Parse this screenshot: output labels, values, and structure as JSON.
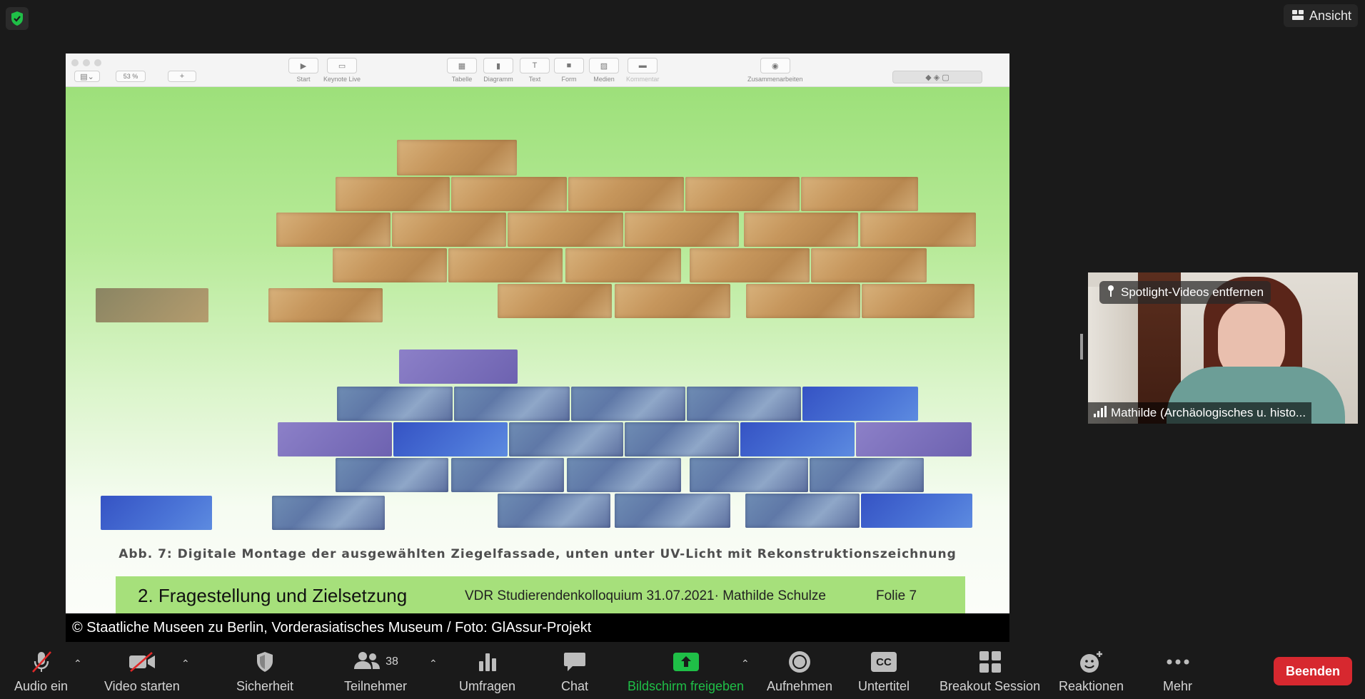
{
  "top": {
    "view_label": "Ansicht"
  },
  "keynote": {
    "zoom": "53 %",
    "buttons": [
      "Start",
      "Keynote Live",
      "Tabelle",
      "Diagramm",
      "Text",
      "Form",
      "Medien",
      "Kommentar",
      "Zusammenarbeiten"
    ]
  },
  "slide": {
    "caption": "Abb. 7: Digitale Montage der ausgewählten Ziegelfassade, unten unter UV-Licht mit Rekonstruktionszeichnung",
    "footer_title": "2. Fragestellung und Zielsetzung",
    "footer_event": "VDR Studierendenkolloquium  31.07.2021· Mathilde Schulze",
    "footer_slide": "Folie 7",
    "copyright": "© Staatliche Museen zu Berlin, Vorderasiatisches Museum / Foto: GlAssur-Projekt"
  },
  "video": {
    "spotlight_label": "Spotlight-Videos entfernen",
    "participant_name": "Mathilde (Archäologisches u. histo..."
  },
  "toolbar": {
    "audio": "Audio ein",
    "video": "Video starten",
    "security": "Sicherheit",
    "participants": "Teilnehmer",
    "participants_count": "38",
    "polls": "Umfragen",
    "chat": "Chat",
    "share": "Bildschirm freigeben",
    "record": "Aufnehmen",
    "captions": "Untertitel",
    "captions_icon_text": "CC",
    "breakout": "Breakout Session",
    "reactions": "Reaktionen",
    "more": "Mehr",
    "end": "Beenden"
  },
  "colors": {
    "share_green": "#1fbf47",
    "end_red": "#d7282f",
    "slide_footer": "#a6e07b"
  }
}
